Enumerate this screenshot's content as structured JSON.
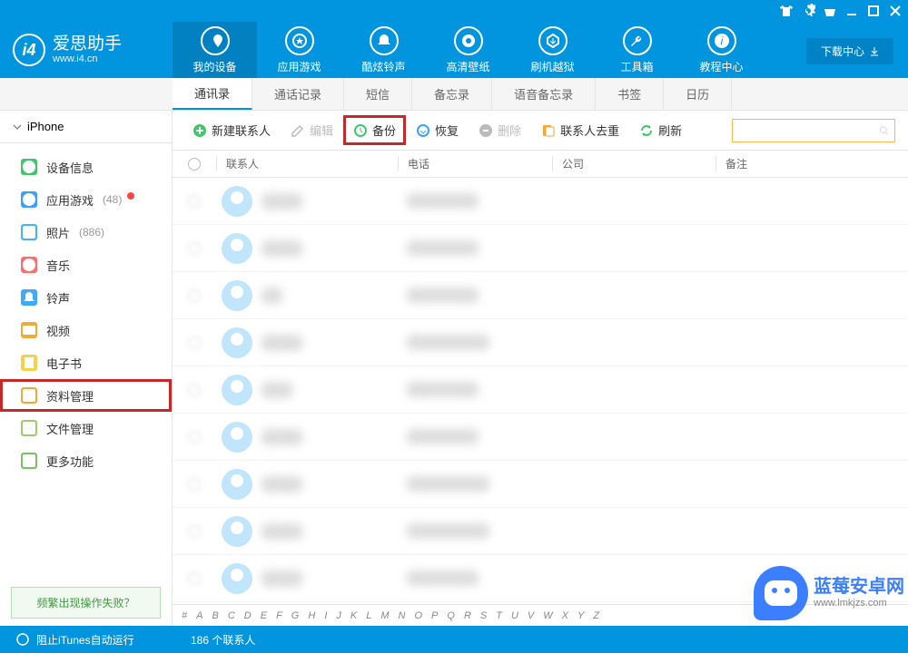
{
  "app": {
    "name_cn": "爱思助手",
    "name_en": "www.i4.cn"
  },
  "sysbar": {
    "icons": [
      "tshirt",
      "gear",
      "skin",
      "minimize",
      "maximize",
      "close"
    ]
  },
  "download_center": "下载中心",
  "nav": [
    {
      "id": "device",
      "label": "我的设备",
      "active": true
    },
    {
      "id": "apps",
      "label": "应用游戏"
    },
    {
      "id": "ringtones",
      "label": "酷炫铃声"
    },
    {
      "id": "wallpapers",
      "label": "高清壁纸"
    },
    {
      "id": "flash",
      "label": "刷机越狱"
    },
    {
      "id": "toolbox",
      "label": "工具箱"
    },
    {
      "id": "tutorials",
      "label": "教程中心"
    }
  ],
  "tabs": [
    {
      "id": "contacts",
      "label": "通讯录",
      "active": true
    },
    {
      "id": "calls",
      "label": "通话记录"
    },
    {
      "id": "sms",
      "label": "短信"
    },
    {
      "id": "memo",
      "label": "备忘录"
    },
    {
      "id": "voice",
      "label": "语音备忘录"
    },
    {
      "id": "bookmarks",
      "label": "书签"
    },
    {
      "id": "calendar",
      "label": "日历"
    }
  ],
  "sidebar": {
    "device": "iPhone",
    "items": [
      {
        "id": "info",
        "label": "设备信息",
        "color": "#43c56d"
      },
      {
        "id": "apps",
        "label": "应用游戏",
        "count": "(48)",
        "dot": true,
        "color": "#3aa0ff"
      },
      {
        "id": "photos",
        "label": "照片",
        "count": "(886)",
        "color": "#40b4ff"
      },
      {
        "id": "music",
        "label": "音乐",
        "color": "#ff6e6e"
      },
      {
        "id": "ring",
        "label": "铃声",
        "color": "#3fa8ff"
      },
      {
        "id": "video",
        "label": "视频",
        "color": "#f2a93b"
      },
      {
        "id": "ebook",
        "label": "电子书",
        "color": "#f7d14a"
      },
      {
        "id": "data",
        "label": "资料管理",
        "color": "#f2a93b",
        "highlight": true
      },
      {
        "id": "files",
        "label": "文件管理",
        "color": "#a7c96e"
      },
      {
        "id": "more",
        "label": "更多功能",
        "color": "#7cbf6c"
      }
    ],
    "help": "频繁出现操作失败？"
  },
  "toolbar": [
    {
      "id": "new",
      "label": "新建联系人",
      "color": "#43c56d"
    },
    {
      "id": "edit",
      "label": "编辑",
      "disabled": true,
      "color": "#bbb"
    },
    {
      "id": "backup",
      "label": "备份",
      "color": "#43c56d",
      "highlight": true
    },
    {
      "id": "restore",
      "label": "恢复",
      "color": "#3aa0ff"
    },
    {
      "id": "delete",
      "label": "删除",
      "disabled": true,
      "color": "#bbb"
    },
    {
      "id": "dedupe",
      "label": "联系人去重",
      "color": "#f2a93b"
    },
    {
      "id": "refresh",
      "label": "刷新",
      "color": "#43c56d"
    }
  ],
  "search": {
    "placeholder": ""
  },
  "columns": {
    "contact": "联系人",
    "phone": "电话",
    "company": "公司",
    "notes": "备注"
  },
  "rows": [
    {
      "name": "████",
      "phone": "███████"
    },
    {
      "name": "████",
      "phone": "███████"
    },
    {
      "name": "██",
      "phone": "███████"
    },
    {
      "name": "████",
      "phone": "████████"
    },
    {
      "name": "███",
      "phone": "███████"
    },
    {
      "name": "████",
      "phone": "███████"
    },
    {
      "name": "████",
      "phone": "████████"
    },
    {
      "name": "████",
      "phone": "████████"
    },
    {
      "name": "████",
      "phone": "███████"
    }
  ],
  "alpha": [
    "#",
    "A",
    "B",
    "C",
    "D",
    "E",
    "F",
    "G",
    "H",
    "I",
    "J",
    "K",
    "L",
    "M",
    "N",
    "O",
    "P",
    "Q",
    "R",
    "S",
    "T",
    "U",
    "V",
    "W",
    "X",
    "Y",
    "Z"
  ],
  "status": {
    "itunes": "阻止iTunes自动运行",
    "count": "186 个联系人"
  },
  "watermark": {
    "cn": "蓝莓安卓网",
    "en": "www.lmkjzs.com"
  }
}
